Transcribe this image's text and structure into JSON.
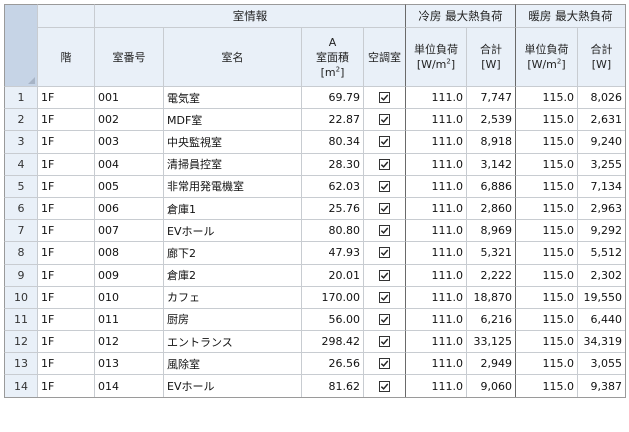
{
  "groups": {
    "room_info": "室情報",
    "cooling": "冷房 最大熱負荷",
    "heating": "暖房 最大熱負荷"
  },
  "columns": {
    "floor": "階",
    "room_no": "室番号",
    "room_name": "室名",
    "area_a": "A",
    "area_label": "室面積",
    "area_unit_pre": "[m",
    "area_unit_sup": "2",
    "area_unit_post": "]",
    "aircon": "空調室",
    "cool_unit_label": "単位負荷",
    "cool_unit_pre": "[W/m",
    "cool_unit_sup": "2",
    "cool_unit_post": "]",
    "cool_total_label": "合計",
    "cool_total_unit": "[W]",
    "heat_unit_label": "単位負荷",
    "heat_unit_pre": "[W/m",
    "heat_unit_sup": "2",
    "heat_unit_post": "]",
    "heat_total_label": "合計",
    "heat_total_unit": "[W]"
  },
  "rows": [
    {
      "n": "1",
      "floor": "1F",
      "room_no": "001",
      "room_name": "電気室",
      "area": "69.79",
      "aircon": true,
      "cool_unit": "111.0",
      "cool_total": "7,747",
      "heat_unit": "115.0",
      "heat_total": "8,026"
    },
    {
      "n": "2",
      "floor": "1F",
      "room_no": "002",
      "room_name": "MDF室",
      "area": "22.87",
      "aircon": true,
      "cool_unit": "111.0",
      "cool_total": "2,539",
      "heat_unit": "115.0",
      "heat_total": "2,631"
    },
    {
      "n": "3",
      "floor": "1F",
      "room_no": "003",
      "room_name": "中央監視室",
      "area": "80.34",
      "aircon": true,
      "cool_unit": "111.0",
      "cool_total": "8,918",
      "heat_unit": "115.0",
      "heat_total": "9,240"
    },
    {
      "n": "4",
      "floor": "1F",
      "room_no": "004",
      "room_name": "清掃員控室",
      "area": "28.30",
      "aircon": true,
      "cool_unit": "111.0",
      "cool_total": "3,142",
      "heat_unit": "115.0",
      "heat_total": "3,255"
    },
    {
      "n": "5",
      "floor": "1F",
      "room_no": "005",
      "room_name": "非常用発電機室",
      "area": "62.03",
      "aircon": true,
      "cool_unit": "111.0",
      "cool_total": "6,886",
      "heat_unit": "115.0",
      "heat_total": "7,134"
    },
    {
      "n": "6",
      "floor": "1F",
      "room_no": "006",
      "room_name": "倉庫1",
      "area": "25.76",
      "aircon": true,
      "cool_unit": "111.0",
      "cool_total": "2,860",
      "heat_unit": "115.0",
      "heat_total": "2,963"
    },
    {
      "n": "7",
      "floor": "1F",
      "room_no": "007",
      "room_name": "EVホール",
      "area": "80.80",
      "aircon": true,
      "cool_unit": "111.0",
      "cool_total": "8,969",
      "heat_unit": "115.0",
      "heat_total": "9,292"
    },
    {
      "n": "8",
      "floor": "1F",
      "room_no": "008",
      "room_name": "廊下2",
      "area": "47.93",
      "aircon": true,
      "cool_unit": "111.0",
      "cool_total": "5,321",
      "heat_unit": "115.0",
      "heat_total": "5,512"
    },
    {
      "n": "9",
      "floor": "1F",
      "room_no": "009",
      "room_name": "倉庫2",
      "area": "20.01",
      "aircon": true,
      "cool_unit": "111.0",
      "cool_total": "2,222",
      "heat_unit": "115.0",
      "heat_total": "2,302"
    },
    {
      "n": "10",
      "floor": "1F",
      "room_no": "010",
      "room_name": "カフェ",
      "area": "170.00",
      "aircon": true,
      "cool_unit": "111.0",
      "cool_total": "18,870",
      "heat_unit": "115.0",
      "heat_total": "19,550"
    },
    {
      "n": "11",
      "floor": "1F",
      "room_no": "011",
      "room_name": "厨房",
      "area": "56.00",
      "aircon": true,
      "cool_unit": "111.0",
      "cool_total": "6,216",
      "heat_unit": "115.0",
      "heat_total": "6,440"
    },
    {
      "n": "12",
      "floor": "1F",
      "room_no": "012",
      "room_name": "エントランス",
      "area": "298.42",
      "aircon": true,
      "cool_unit": "111.0",
      "cool_total": "33,125",
      "heat_unit": "115.0",
      "heat_total": "34,319"
    },
    {
      "n": "13",
      "floor": "1F",
      "room_no": "013",
      "room_name": "風除室",
      "area": "26.56",
      "aircon": true,
      "cool_unit": "111.0",
      "cool_total": "2,949",
      "heat_unit": "115.0",
      "heat_total": "3,055"
    },
    {
      "n": "14",
      "floor": "1F",
      "room_no": "014",
      "room_name": "EVホール",
      "area": "81.62",
      "aircon": true,
      "cool_unit": "111.0",
      "cool_total": "9,060",
      "heat_unit": "115.0",
      "heat_total": "9,387"
    }
  ],
  "colors": {
    "header_bg": "#e9f0f8",
    "corner_bg": "#c6d4e6",
    "grid_line": "#c8ccd1",
    "group_separator": "#6a6a6a"
  },
  "icons": {
    "checkbox": "checkbox-checked-icon"
  }
}
